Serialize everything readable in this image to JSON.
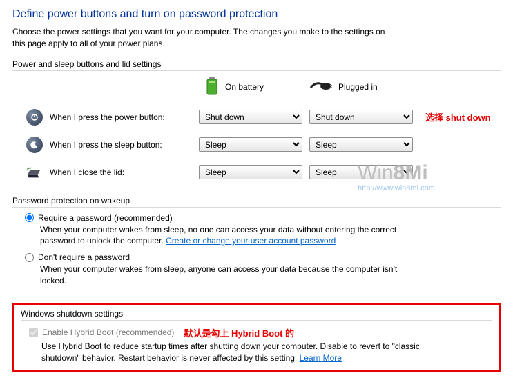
{
  "title": "Define power buttons and turn on password protection",
  "intro": "Choose the power settings that you want for your computer. The changes you make to the settings on this page apply to all of your power plans.",
  "section1": "Power and sleep buttons and lid settings",
  "cols": {
    "battery": "On battery",
    "plugged": "Plugged in"
  },
  "rows": {
    "power": {
      "label": "When I press the power button:",
      "battery": "Shut down",
      "plugged": "Shut down"
    },
    "sleep": {
      "label": "When I press the sleep button:",
      "battery": "Sleep",
      "plugged": "Sleep"
    },
    "lid": {
      "label": "When I close the lid:",
      "battery": "Sleep",
      "plugged": "Sleep"
    }
  },
  "annotation1": "选择 shut down",
  "pwd": {
    "section": "Password protection on wakeup",
    "opt1": "Require a password (recommended)",
    "desc1a": "When your computer wakes from sleep, no one can access your data without entering the correct password to unlock the computer. ",
    "link1": "Create or change your user account password",
    "opt2": "Don't require a password",
    "desc2": "When your computer wakes from sleep, anyone can access your data because the computer isn't locked."
  },
  "watermark": {
    "brand": "Win8Mi",
    "url": "http://www.win8mi.com"
  },
  "shutdown": {
    "section": "Windows shutdown settings",
    "cb": "Enable Hybrid Boot (recommended)",
    "annotation": "默认是勾上 Hybrid Boot 的",
    "desc": "Use Hybrid Boot to reduce startup times after shutting down your computer. Disable to revert to \"classic shutdown\" behavior. Restart behavior is never affected by this setting. ",
    "link": "Learn More"
  }
}
